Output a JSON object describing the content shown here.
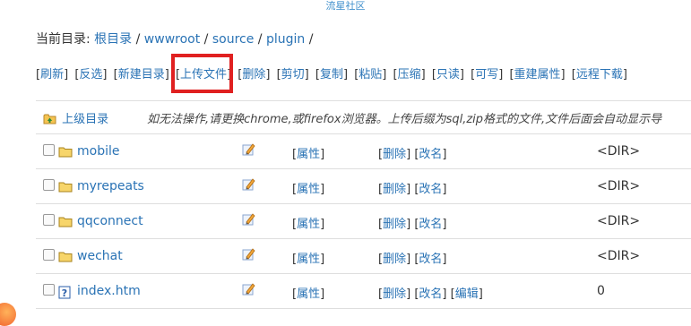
{
  "site_title": "流星社区",
  "breadcrumb": {
    "prefix": "当前目录:",
    "items": [
      "根目录",
      "wwwroot",
      "source",
      "plugin"
    ],
    "separator": "/"
  },
  "toolbar": {
    "buttons": [
      "刷新",
      "反选",
      "新建目录",
      "上传文件",
      "删除",
      "剪切",
      "复制",
      "粘贴",
      "压缩",
      "只读",
      "可写",
      "重建属性",
      "远程下载"
    ],
    "highlighted": "上传文件",
    "highlight_color": "#e02020"
  },
  "parent_dir": {
    "label": "上级目录",
    "hint": "如无法操作,请更换chrome,或firefox浏览器。上传后缀为sql,zip格式的文件,文件后面会自动显示导"
  },
  "files": [
    {
      "name": "mobile",
      "type": "folder",
      "attr": "属性",
      "ops": [
        "删除",
        "改名"
      ],
      "size": "<DIR>"
    },
    {
      "name": "myrepeats",
      "type": "folder",
      "attr": "属性",
      "ops": [
        "删除",
        "改名"
      ],
      "size": "<DIR>"
    },
    {
      "name": "qqconnect",
      "type": "folder",
      "attr": "属性",
      "ops": [
        "删除",
        "改名"
      ],
      "size": "<DIR>"
    },
    {
      "name": "wechat",
      "type": "folder",
      "attr": "属性",
      "ops": [
        "删除",
        "改名"
      ],
      "size": "<DIR>"
    },
    {
      "name": "index.htm",
      "type": "file",
      "attr": "属性",
      "ops": [
        "删除",
        "改名",
        "编辑"
      ],
      "size": "0"
    }
  ],
  "colors": {
    "link": "#2a73b5",
    "title": "#3d8ecb",
    "divider": "#dedede"
  }
}
